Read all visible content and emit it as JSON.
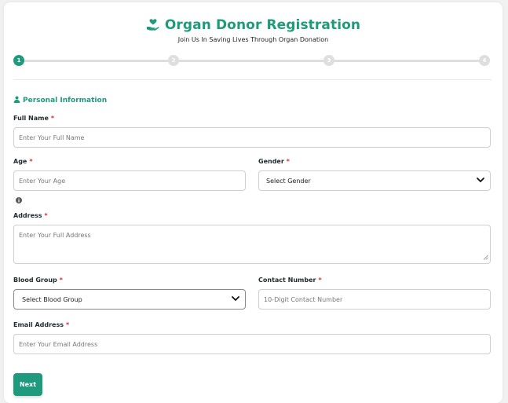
{
  "header": {
    "title": "Organ Donor Registration",
    "subtitle": "Join Us In Saving Lives Through Organ Donation",
    "icon": "hand-heart-icon"
  },
  "stepper": {
    "steps": [
      "1",
      "2",
      "3",
      "4"
    ],
    "active_step": "1"
  },
  "section": {
    "title": "Personal Information",
    "icon": "user-icon"
  },
  "form": {
    "full_name": {
      "label": "Full Name",
      "required_mark": "*",
      "placeholder": "Enter Your Full Name"
    },
    "age": {
      "label": "Age",
      "required_mark": "*",
      "placeholder": "Enter Your Age"
    },
    "gender": {
      "label": "Gender",
      "required_mark": "*",
      "selected": "Select Gender"
    },
    "address": {
      "label": "Address",
      "required_mark": "*",
      "placeholder": "Enter Your Full Address"
    },
    "blood_group": {
      "label": "Blood Group",
      "required_mark": "*",
      "selected": "Select Blood Group"
    },
    "contact": {
      "label": "Contact Number",
      "required_mark": "*",
      "placeholder": "10-Digit Contact Number"
    },
    "email": {
      "label": "Email Address",
      "required_mark": "*",
      "placeholder": "Enter Your Email Address"
    }
  },
  "actions": {
    "next_label": "Next"
  },
  "colors": {
    "accent": "#1f9a7c",
    "required": "#d32f2f",
    "inactive_step": "#dedede"
  }
}
